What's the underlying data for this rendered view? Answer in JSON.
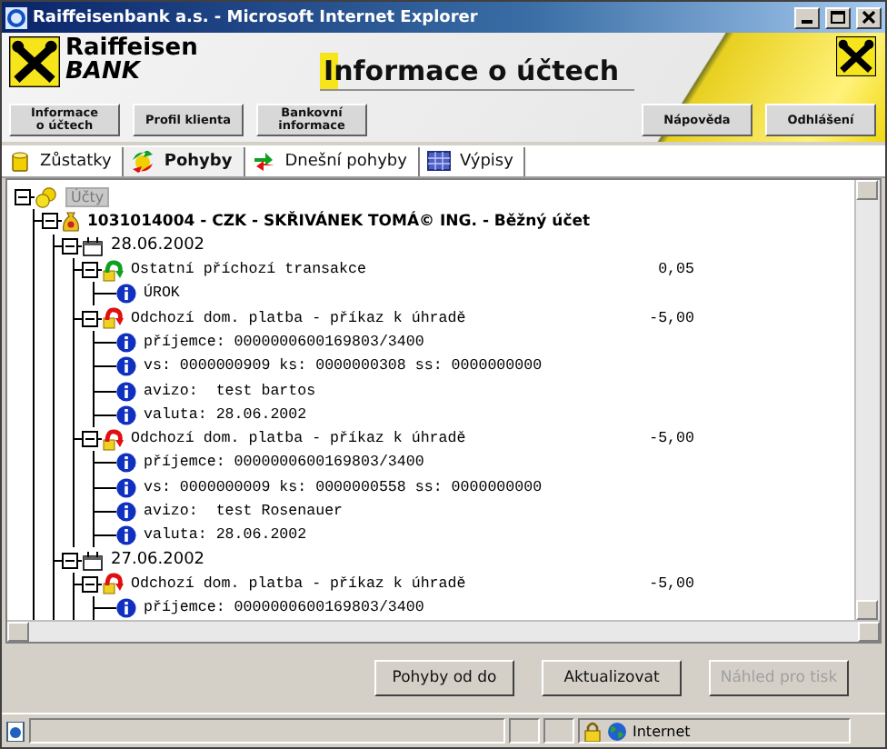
{
  "window": {
    "title": "Raiffeisenbank a.s. - Microsoft Internet Explorer"
  },
  "header": {
    "brand": [
      "Raiffeisen",
      "BANK"
    ],
    "title": "Informace o účtech"
  },
  "nav": {
    "left": [
      "Informace\no účtech",
      "Profil klienta",
      "Bankovní\ninformace"
    ],
    "right": [
      "Nápověda",
      "Odhlášení"
    ]
  },
  "tabs": [
    {
      "label": "Zůstatky",
      "selected": false
    },
    {
      "label": "Pohyby",
      "selected": true
    },
    {
      "label": "Dnešní pohyby",
      "selected": false
    },
    {
      "label": "Výpisy",
      "selected": false
    }
  ],
  "tree": {
    "kind": "root",
    "label": "Účty",
    "expanded": true,
    "children": [
      {
        "kind": "account",
        "label": "1031014004 - CZK - SKŘIVÁNEK TOMÁ© ING. - Běžný účet",
        "expanded": true,
        "children": [
          {
            "kind": "date",
            "label": "28.06.2002",
            "expanded": true,
            "children": [
              {
                "kind": "incoming",
                "label": "Ostatní příchozí transakce",
                "amount": "0,05",
                "expanded": true,
                "children": [
                  {
                    "kind": "info",
                    "label": "ÚROK"
                  }
                ]
              },
              {
                "kind": "outgoing",
                "label": "Odchozí dom. platba - příkaz k úhradě",
                "amount": "-5,00",
                "expanded": true,
                "children": [
                  {
                    "kind": "info",
                    "label": "příjemce: 0000000600169803/3400"
                  },
                  {
                    "kind": "info",
                    "label": "vs: 0000000909 ks: 0000000308 ss: 0000000000"
                  },
                  {
                    "kind": "info",
                    "label": "avizo:  test bartos"
                  },
                  {
                    "kind": "info",
                    "label": "valuta: 28.06.2002"
                  }
                ]
              },
              {
                "kind": "outgoing",
                "label": "Odchozí dom. platba - příkaz k úhradě",
                "amount": "-5,00",
                "expanded": true,
                "children": [
                  {
                    "kind": "info",
                    "label": "příjemce: 0000000600169803/3400"
                  },
                  {
                    "kind": "info",
                    "label": "vs: 0000000009 ks: 0000000558 ss: 0000000000"
                  },
                  {
                    "kind": "info",
                    "label": "avizo:  test Rosenauer"
                  },
                  {
                    "kind": "info",
                    "label": "valuta: 28.06.2002"
                  }
                ]
              }
            ]
          },
          {
            "kind": "date",
            "label": "27.06.2002",
            "expanded": true,
            "children": [
              {
                "kind": "outgoing",
                "label": "Odchozí dom. platba - příkaz k úhradě",
                "amount": "-5,00",
                "expanded": true,
                "children": [
                  {
                    "kind": "info",
                    "label": "příjemce: 0000000600169803/3400"
                  }
                ]
              }
            ]
          }
        ]
      }
    ]
  },
  "buttons": [
    {
      "label": "Pohyby od do",
      "disabled": false
    },
    {
      "label": "Aktualizovat",
      "disabled": false
    },
    {
      "label": "Náhled pro tisk",
      "disabled": true
    }
  ],
  "status_bar": {
    "zone": "Internet"
  }
}
